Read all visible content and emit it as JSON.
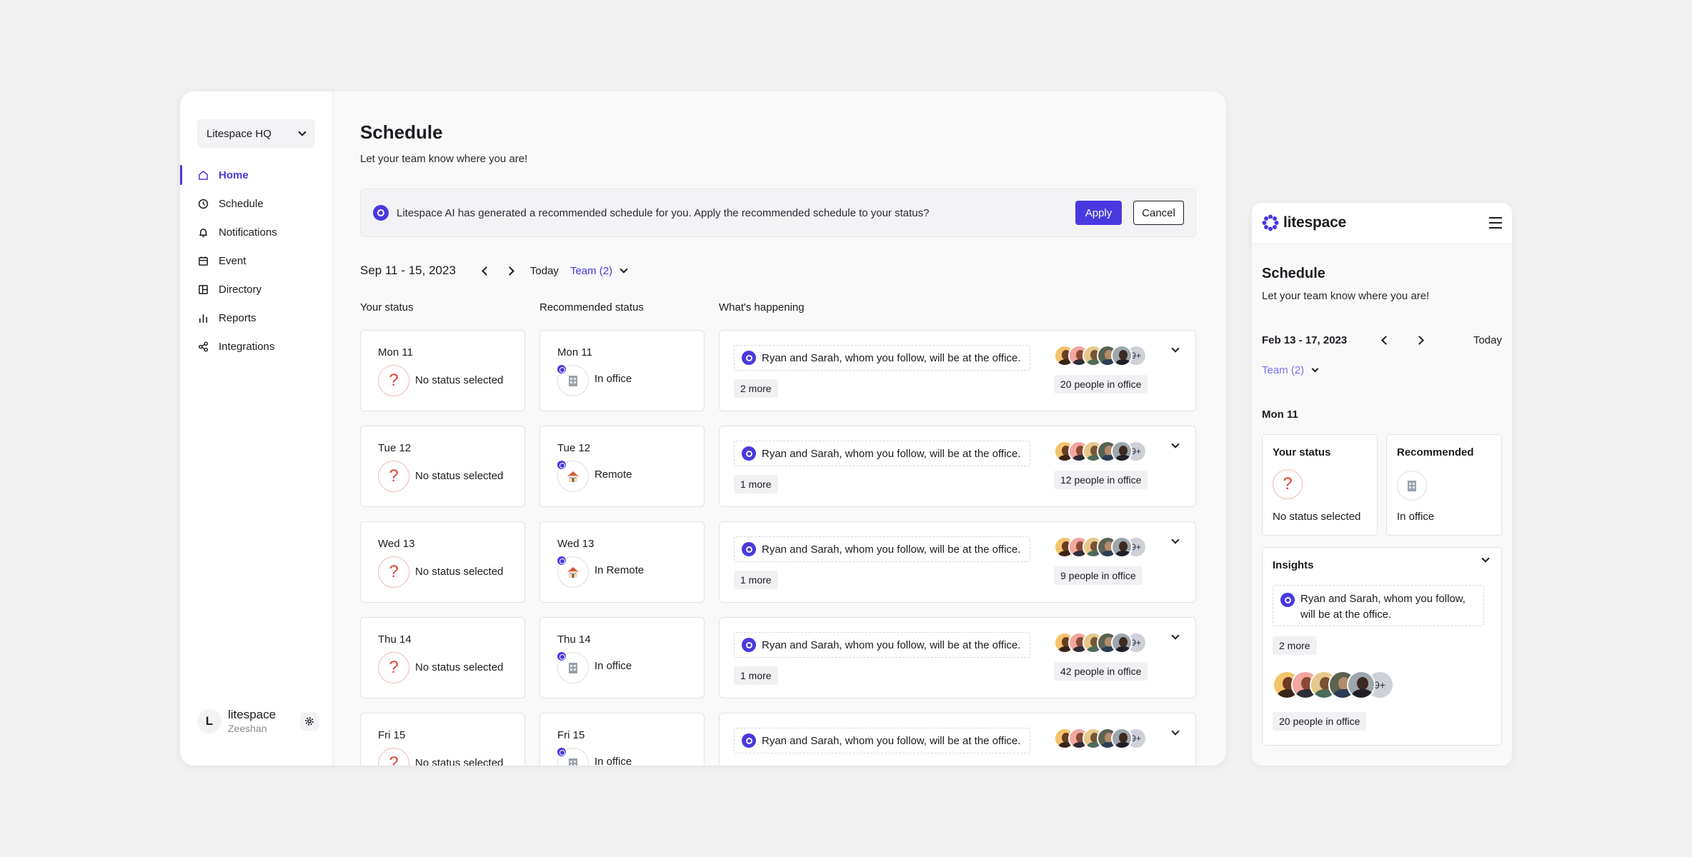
{
  "sidebar": {
    "workspace": "Litespace HQ",
    "items": [
      {
        "label": "Home"
      },
      {
        "label": "Schedule"
      },
      {
        "label": "Notifications"
      },
      {
        "label": "Event"
      },
      {
        "label": "Directory"
      },
      {
        "label": "Reports"
      },
      {
        "label": "Integrations"
      }
    ],
    "user": {
      "initial": "L",
      "name": "litespace",
      "sub": "Zeeshan"
    }
  },
  "main": {
    "title": "Schedule",
    "subtitle": "Let your team know where you are!",
    "banner": {
      "text": "Litespace AI has generated a recommended schedule for you. Apply the recommended schedule to your status?",
      "apply": "Apply",
      "cancel": "Cancel"
    },
    "toolbar": {
      "range": "Sep 11 - 15, 2023",
      "today": "Today",
      "team": "Team (2)"
    },
    "columns": {
      "your_status": "Your status",
      "recommended": "Recommended status",
      "happening": "What's happening"
    },
    "rows": [
      {
        "day": "Mon 11",
        "your": "No status selected",
        "rec": "In office",
        "rec_icon": "office",
        "insight": "Ryan and Sarah, whom you follow, will be at the office.",
        "more": "2 more",
        "people": "20 people in office",
        "avatar_more": "9+"
      },
      {
        "day": "Tue 12",
        "your": "No status selected",
        "rec": "Remote",
        "rec_icon": "home",
        "insight": "Ryan and Sarah, whom you follow, will be at the office.",
        "more": "1 more",
        "people": "12 people in office",
        "avatar_more": "9+"
      },
      {
        "day": "Wed 13",
        "your": "No status selected",
        "rec": "In Remote",
        "rec_icon": "home",
        "insight": "Ryan and Sarah, whom you follow, will be at the office.",
        "more": "1 more",
        "people": "9 people in office",
        "avatar_more": "9+"
      },
      {
        "day": "Thu 14",
        "your": "No status selected",
        "rec": "In office",
        "rec_icon": "office",
        "insight": "Ryan and Sarah, whom you follow, will be at the office.",
        "more": "1 more",
        "people": "42 people in office",
        "avatar_more": "9+"
      },
      {
        "day": "Fri 15",
        "your": "No status selected",
        "rec": "In office",
        "rec_icon": "office",
        "insight": "Ryan and Sarah, whom you follow, will be at the office.",
        "more": "",
        "people": "",
        "avatar_more": "9+"
      }
    ]
  },
  "mobile": {
    "brand": "litespace",
    "title": "Schedule",
    "subtitle": "Let your team know where you are!",
    "range": "Feb 13 - 17, 2023",
    "today": "Today",
    "team": "Team (2)",
    "day": "Mon 11",
    "your_status_title": "Your status",
    "your_status": "No status selected",
    "recommended_title": "Recommended",
    "recommended": "In office",
    "insights_title": "Insights",
    "insight": "Ryan and Sarah, whom you follow, will be at the office.",
    "more": "2 more",
    "avatar_more": "9+",
    "people": "20 people in office"
  },
  "colors": {
    "accent": "#4a39e0",
    "danger": "#e3423c",
    "text": "#1c1c21"
  }
}
